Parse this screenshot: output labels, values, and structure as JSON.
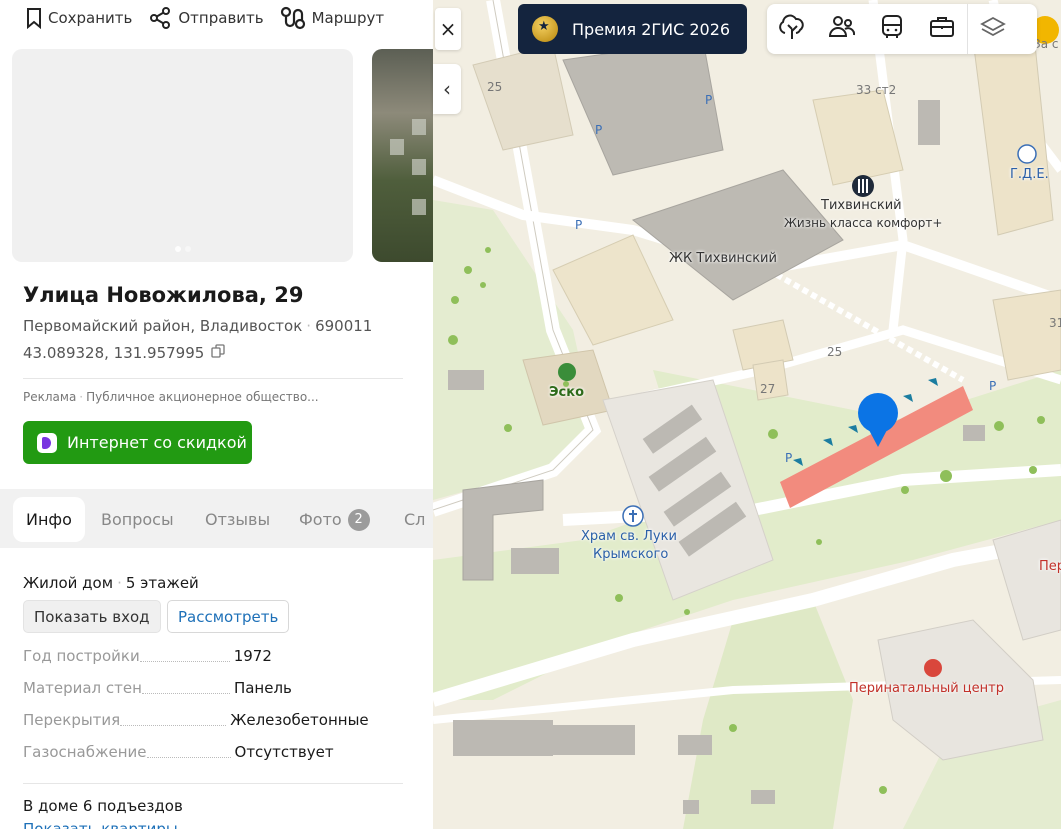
{
  "toolbar": {
    "save": "Сохранить",
    "share": "Отправить",
    "route": "Маршрут"
  },
  "object": {
    "title": "Улица Новожилова, 29",
    "district": "Первомайский район, Владивосток",
    "postcode": "690011",
    "coords": "43.089328, 131.957995"
  },
  "ad": {
    "label": "Реклама",
    "advertiser": "Публичное акционерное общество...",
    "button": "Интернет со скидкой"
  },
  "tabs": {
    "info": "Инфо",
    "questions": "Вопросы",
    "reviews": "Отзывы",
    "photos": "Фото",
    "photos_count": "2",
    "more": "Сл"
  },
  "info": {
    "kind": "Жилой дом",
    "floors": "5 этажей",
    "show_entrance": "Показать вход",
    "inspect": "Рассмотреть",
    "props": [
      {
        "key": "Год постройки",
        "value": "1972"
      },
      {
        "key": "Материал стен",
        "value": "Панель"
      },
      {
        "key": "Перекрытия",
        "value": "Железобетонные"
      },
      {
        "key": "Газоснабжение",
        "value": "Отсутствует"
      }
    ],
    "entrances": "В доме 6 подъездов",
    "show_flats": "Показать квартиры"
  },
  "map": {
    "close": "×",
    "collapse": "‹",
    "award": "Премия 2ГИС 2026",
    "labels": {
      "tikhvinsky": "Тихвинский",
      "tikhvinsky_sub": "Жизнь класса комфорт+",
      "zhk": "ЖК Тихвинский",
      "esko": "Эско",
      "church1": "Храм св. Луки",
      "church2": "Крымского",
      "perinatal": "Перинатальный центр",
      "gde": "Г.Д.Е.",
      "per": "Пер",
      "za": "За с",
      "n25a": "25",
      "n33": "33 ст2",
      "n25b": "25",
      "n27": "27",
      "n31": "31",
      "parking": "P"
    }
  },
  "colors": {
    "accent": "#229a12",
    "link": "#1d70b8",
    "award_bg": "#14243e",
    "building_hl": "#f28b7e",
    "pin": "#0b74e5"
  }
}
